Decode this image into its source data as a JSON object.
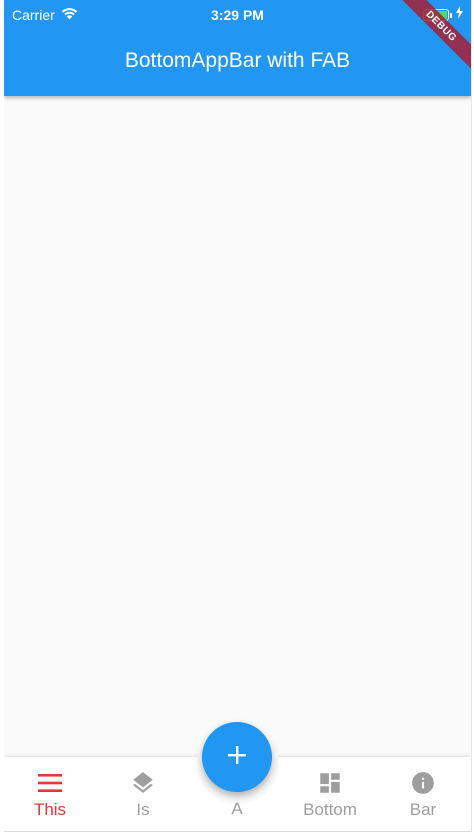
{
  "status_bar": {
    "carrier": "Carrier",
    "time": "3:29 PM",
    "wifi_icon": "wifi-icon",
    "battery_icon": "battery-icon",
    "charging_icon": "bolt-icon"
  },
  "app_bar": {
    "title": "BottomAppBar with FAB",
    "color": "#2196f3"
  },
  "debug_banner": "DEBUG",
  "bottom_bar": {
    "items": [
      {
        "label": "This",
        "icon": "menu-icon",
        "active": true
      },
      {
        "label": "Is",
        "icon": "layers-icon",
        "active": false
      },
      {
        "label": "A",
        "icon": "add-icon",
        "active": false
      },
      {
        "label": "Bottom",
        "icon": "dashboard-icon",
        "active": false
      },
      {
        "label": "Bar",
        "icon": "info-icon",
        "active": false
      }
    ],
    "active_color": "#e53935",
    "inactive_color": "#9e9e9e"
  },
  "fab": {
    "icon": "add-icon",
    "color": "#2196f3"
  }
}
